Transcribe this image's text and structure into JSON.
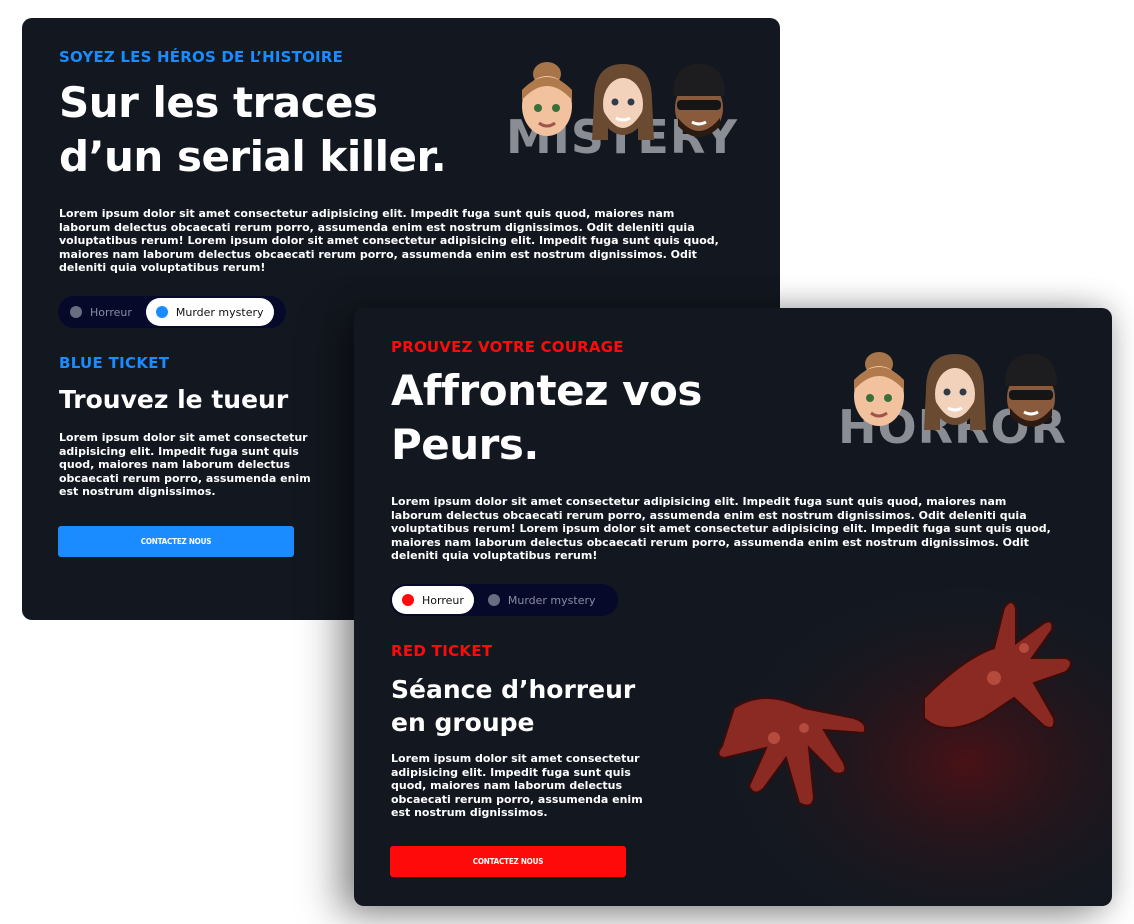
{
  "mystery": {
    "eyebrow": "SOYEZ LES HÉROS DE L’HISTOIRE",
    "headline_line1": "Sur les traces",
    "headline_line2": "d’un serial killer.",
    "paragraph": "Lorem ipsum dolor sit amet consectetur adipisicing elit. Impedit fuga sunt quis quod, maiores nam laborum delectus obcaecati rerum porro, assumenda enim est nostrum dignissimos. Odit deleniti quia voluptatibus rerum! Lorem ipsum dolor sit amet consectetur adipisicing elit. Impedit fuga sunt quis quod, maiores nam laborum delectus obcaecati rerum porro, assumenda enim est nostrum dignissimos. Odit deleniti quia voluptatibus rerum!",
    "watermark": "MISTERY",
    "toggle": {
      "option1": "Horreur",
      "option2": "Murder mystery",
      "active": "Murder mystery"
    },
    "ticket": "BLUE TICKET",
    "subheading": "Trouvez le tueur",
    "small_paragraph": "Lorem ipsum dolor sit amet consectetur adipisicing elit. Impedit fuga sunt quis quod, maiores nam laborum delectus obcaecati rerum porro, assumenda enim est nostrum dignissimos.",
    "cta": "CONTACTEZ NOUS",
    "accent": "#1a8cff"
  },
  "horror": {
    "eyebrow": "PROUVEZ VOTRE COURAGE",
    "headline_line1": "Affrontez vos",
    "headline_line2": "Peurs.",
    "paragraph": "Lorem ipsum dolor sit amet consectetur adipisicing elit. Impedit fuga sunt quis quod, maiores nam laborum delectus obcaecati rerum porro, assumenda enim est nostrum dignissimos. Odit deleniti quia voluptatibus rerum! Lorem ipsum dolor sit amet consectetur adipisicing elit. Impedit fuga sunt quis quod, maiores nam laborum delectus obcaecati rerum porro, assumenda enim est nostrum dignissimos. Odit deleniti quia voluptatibus rerum!",
    "watermark": "HORROR",
    "toggle": {
      "option1": "Horreur",
      "option2": "Murder mystery",
      "active": "Horreur"
    },
    "ticket": "RED TICKET",
    "subheading_line1": "Séance d’horreur",
    "subheading_line2": "en groupe",
    "small_paragraph": "Lorem ipsum dolor sit amet consectetur adipisicing elit. Impedit fuga sunt quis quod, maiores nam laborum delectus obcaecati rerum porro, assumenda enim est nostrum dignissimos.",
    "cta": "CONTACTEZ NOUS",
    "accent": "#ff0a0a"
  },
  "colors": {
    "card_background": "#131820",
    "toggle_track": "#06092a",
    "blue": "#1a8cff",
    "red": "#ff0a0a"
  },
  "icons": [
    "woman-avatar-icon",
    "bearded-man-avatar-icon",
    "masked-man-avatar-icon",
    "zombie-hands-illustration"
  ]
}
